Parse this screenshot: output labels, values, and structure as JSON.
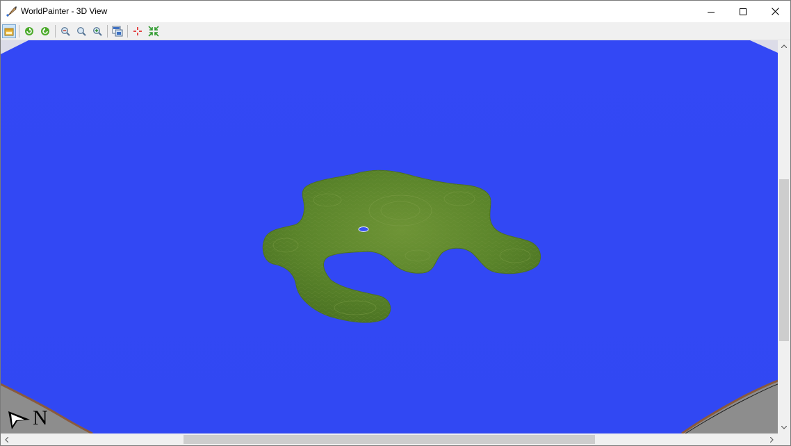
{
  "window": {
    "title": "WorldPainter - 3D View"
  },
  "toolbar": {
    "buttons": [
      {
        "name": "always-on-top-button",
        "icon": "pin-window-icon",
        "pressed": true
      },
      {
        "name": "rotate-left-button",
        "icon": "rotate-ccw-icon"
      },
      {
        "name": "rotate-right-button",
        "icon": "rotate-cw-icon"
      },
      {
        "name": "zoom-out-button",
        "icon": "zoom-out-icon"
      },
      {
        "name": "zoom-reset-button",
        "icon": "zoom-reset-icon"
      },
      {
        "name": "zoom-in-button",
        "icon": "zoom-in-icon"
      },
      {
        "name": "export-image-button",
        "icon": "export-image-icon"
      },
      {
        "name": "move-to-spawn-button",
        "icon": "crosshair-icon"
      },
      {
        "name": "move-to-origin-button",
        "icon": "center-arrows-icon"
      }
    ]
  },
  "compass": {
    "label": "N"
  },
  "colors": {
    "water": "#3249f6",
    "terrain": "#5f8a2e",
    "rock": "#8f8f8f",
    "dirt": "#8a5a3c",
    "titlebar": "#ffffff",
    "chrome": "#f0f0f0"
  }
}
